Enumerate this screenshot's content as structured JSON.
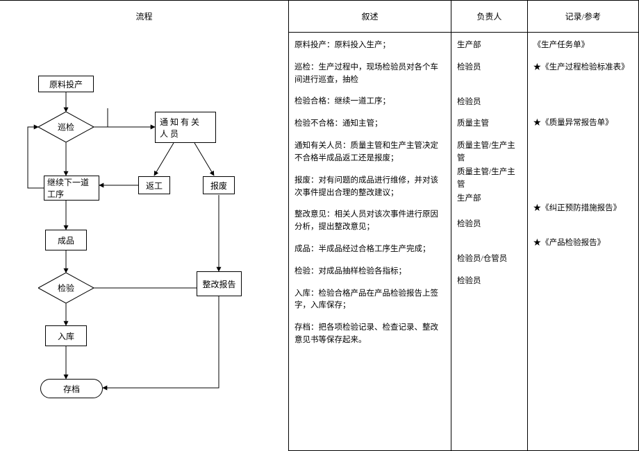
{
  "headers": {
    "flow": "流程",
    "desc": "叙述",
    "resp": "负责人",
    "ref": "记录/参考"
  },
  "flow": {
    "n1": "原料投产",
    "n2": "巡检",
    "n3": "通知有关人员",
    "n4": "继续下一道工序",
    "n5": "返工",
    "n6": "报废",
    "n7": "成品",
    "n8": "检验",
    "n9": "整改报告",
    "n10": "入库",
    "n11": "存档"
  },
  "desc": {
    "r1": "原料投产：原料投入生产；",
    "r2": "巡检：生产过程中，现场检验员对各个车间进行巡查，抽检",
    "r3": "检验合格：继续一道工序；",
    "r4": "检验不合格：通知主管；",
    "r5": "通知有关人员：质量主管和生产主管决定不合格半成品返工还是报废；",
    "r6": "报废：对有问题的成品进行维修，并对该次事件提出合理的整改建议；",
    "r7": "整改意见：相关人员对该次事件进行原因分析，提出整改意见；",
    "r8": "成品：半成品经过合格工序生产完成；",
    "r9": "检验：对成品抽样检验各指标；",
    "r10": "入库：检验合格产品在产品检验报告上签字，入库保存；",
    "r11": "存档：把各项检验记录、检查记录、整改意见书等保存起来。"
  },
  "resp": {
    "r1": "生产部",
    "r2": "检验员",
    "r3": "检验员",
    "r4": "质量主管",
    "r5": "质量主管/生产主管",
    "r6a": "质量主管/生产主管",
    "r6b": "生产部",
    "r7": "检验员",
    "r8": "检验员/仓管员",
    "r9": "检验员"
  },
  "ref": {
    "r1": "《生产任务单》",
    "r2": "★《生产过程检验标准表》",
    "r4": "★《质量异常报告单》",
    "r7": "★《纠正预防措施报告》",
    "r8": "★《产品检验报告》"
  }
}
